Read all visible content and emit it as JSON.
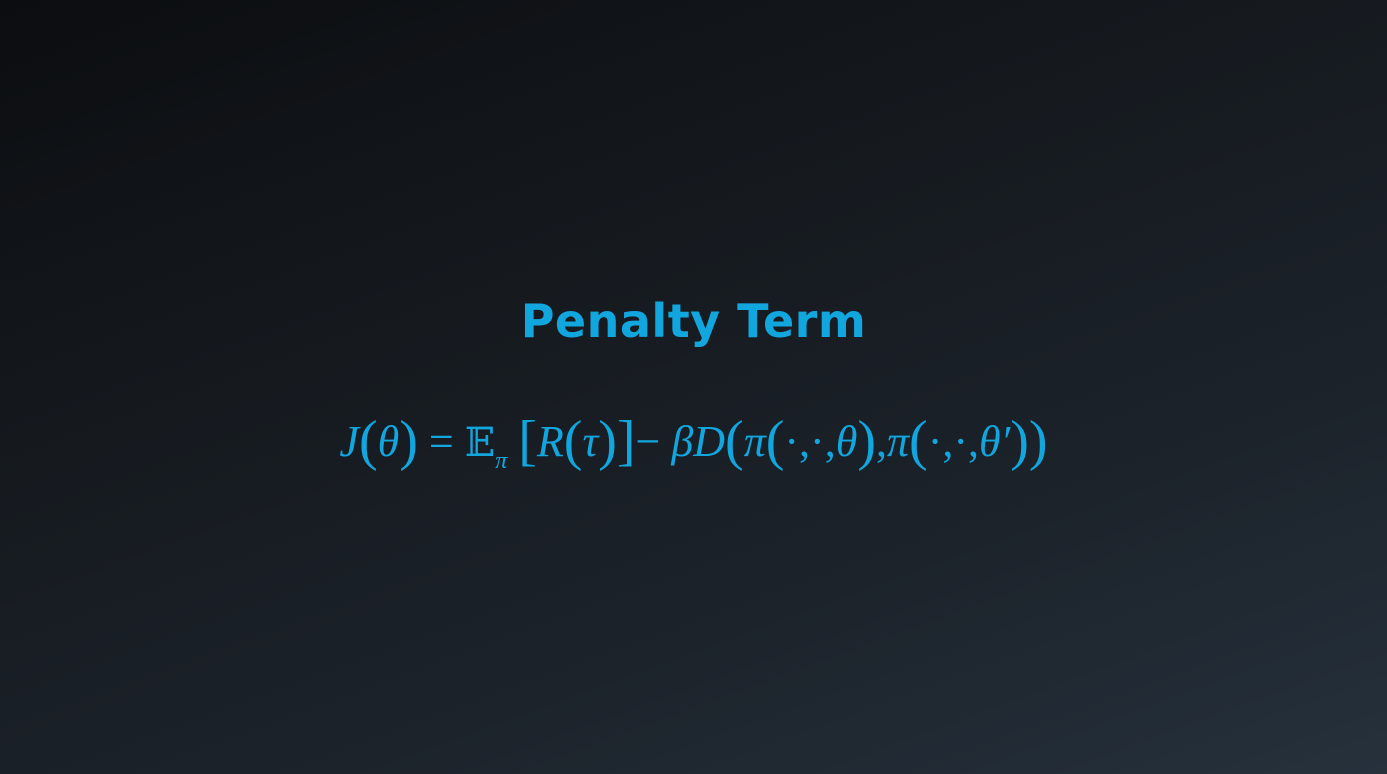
{
  "slide": {
    "title": "Penalty Term",
    "formula": {
      "J": "J",
      "lp1": "(",
      "theta1": "θ",
      "rp1": ")",
      "eq": " = ",
      "E": "𝔼",
      "pi_sub": "π",
      "lbr": "[",
      "R": "R",
      "lp2": "(",
      "tau": "τ",
      "rp2": ")",
      "rbr": "]",
      "minus": "− ",
      "beta": "β",
      "D": "D",
      "lp3": "(",
      "pi1": "π",
      "lp4": "(",
      "args1": "·,·,",
      "theta2": "θ",
      "rp4": ")",
      "comma": ",",
      "pi2": "π",
      "lp5": "(",
      "args2": "·,·,",
      "theta3": "θ′",
      "rp5": ")",
      "rp3": ")"
    }
  },
  "colors": {
    "accent": "#12a6df",
    "background_top": "#0b0d10",
    "background_bottom": "#26313c"
  }
}
